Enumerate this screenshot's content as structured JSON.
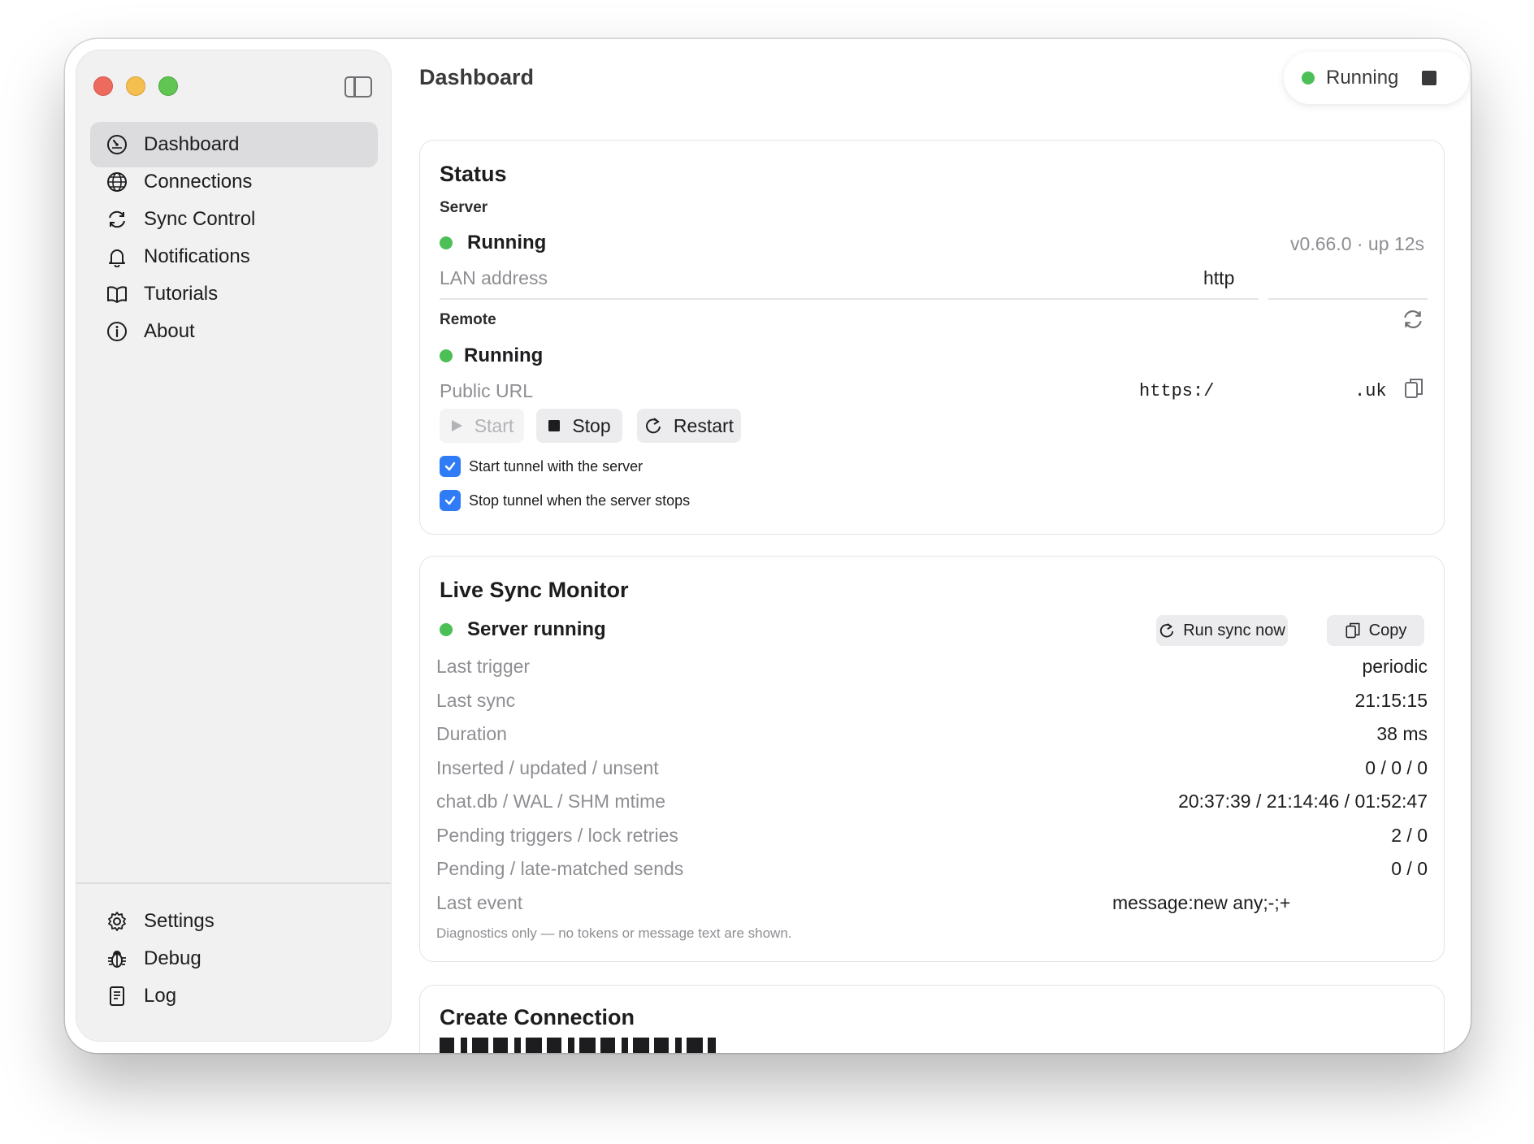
{
  "sidebar": {
    "items": [
      {
        "label": "Dashboard",
        "icon": "gauge-icon"
      },
      {
        "label": "Connections",
        "icon": "globe-icon"
      },
      {
        "label": "Sync Control",
        "icon": "sync-icon"
      },
      {
        "label": "Notifications",
        "icon": "bell-icon"
      },
      {
        "label": "Tutorials",
        "icon": "book-icon"
      },
      {
        "label": "About",
        "icon": "info-icon"
      }
    ],
    "bottom_items": [
      {
        "label": "Settings",
        "icon": "gear-icon"
      },
      {
        "label": "Debug",
        "icon": "bug-icon"
      },
      {
        "label": "Log",
        "icon": "document-icon"
      }
    ]
  },
  "header": {
    "title": "Dashboard",
    "status_label": "Running"
  },
  "status_card": {
    "title": "Status",
    "server": {
      "label": "Server",
      "state": "Running",
      "version": "v0.66.0 · up 12s",
      "lan_label": "LAN address",
      "lan_value": "http"
    },
    "remote": {
      "label": "Remote",
      "state": "Running",
      "url_label": "Public URL",
      "url_prefix": "https:/",
      "url_suffix": ".uk",
      "start_label": "Start",
      "stop_label": "Stop",
      "restart_label": "Restart",
      "check1": "Start tunnel with the server",
      "check2": "Stop tunnel when the server stops"
    }
  },
  "sync_card": {
    "title": "Live Sync Monitor",
    "state": "Server running",
    "run_sync_label": "Run sync now",
    "copy_label": "Copy",
    "rows": [
      {
        "label": "Last trigger",
        "value": "periodic"
      },
      {
        "label": "Last sync",
        "value": "21:15:15"
      },
      {
        "label": "Duration",
        "value": "38 ms"
      },
      {
        "label": "Inserted / updated / unsent",
        "value": "0 / 0 / 0"
      },
      {
        "label": "chat.db / WAL / SHM mtime",
        "value": "20:37:39 / 21:14:46 / 01:52:47"
      },
      {
        "label": "Pending triggers / lock retries",
        "value": "2 / 0"
      },
      {
        "label": "Pending / late-matched sends",
        "value": "0 / 0"
      },
      {
        "label": "Last event",
        "value": "message:new any;-;+"
      }
    ],
    "note": "Diagnostics only — no tokens or message text are shown."
  },
  "create_card": {
    "title": "Create Connection"
  },
  "colors": {
    "running_green": "#4cbf56",
    "checkbox_blue": "#2f7cf6",
    "active_item": "#dcdcde"
  }
}
